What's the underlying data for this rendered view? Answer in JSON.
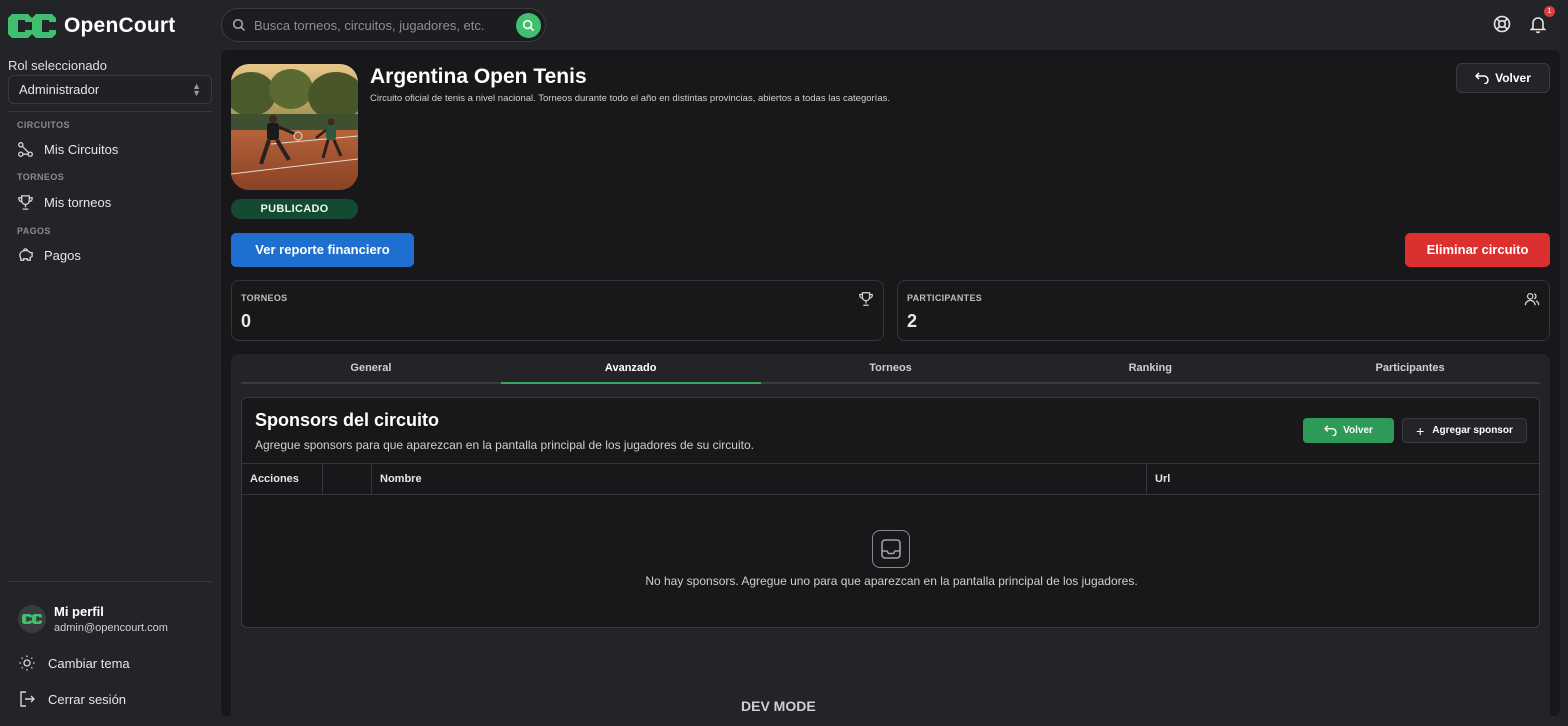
{
  "brand": {
    "name": "OpenCourt",
    "accent": "#3fbf6f"
  },
  "sidebar": {
    "role_label": "Rol seleccionado",
    "role_value": "Administrador",
    "sections": [
      {
        "label": "CIRCUITOS",
        "item": "Mis Circuitos",
        "icon": "circuit-icon"
      },
      {
        "label": "TORNEOS",
        "item": "Mis torneos",
        "icon": "trophy-icon"
      },
      {
        "label": "PAGOS",
        "item": "Pagos",
        "icon": "piggy-bank-icon"
      }
    ],
    "profile": {
      "name": "Mi perfil",
      "email": "admin@opencourt.com"
    },
    "theme_label": "Cambiar tema",
    "logout_label": "Cerrar sesión"
  },
  "search": {
    "placeholder": "Busca torneos, circuitos, jugadores, etc."
  },
  "notifications": {
    "count": "1"
  },
  "circuit": {
    "title": "Argentina Open Tenis",
    "description": "Circuito oficial de tenis a nivel nacional. Torneos durante todo el año en distintas provincias, abiertos a todas las categorías.",
    "status": "PUBLICADO",
    "back_label": "Volver",
    "report_label": "Ver reporte financiero",
    "delete_label": "Eliminar circuito"
  },
  "stats": [
    {
      "label": "TORNEOS",
      "value": "0",
      "icon": "trophy-icon"
    },
    {
      "label": "PARTICIPANTES",
      "value": "2",
      "icon": "users-icon"
    }
  ],
  "tabs": [
    "General",
    "Avanzado",
    "Torneos",
    "Ranking",
    "Participantes"
  ],
  "active_tab": "Avanzado",
  "sponsors": {
    "title": "Sponsors del circuito",
    "description": "Agregue sponsors para que aparezcan en la pantalla principal de los jugadores de su circuito.",
    "back_label": "Volver",
    "add_label": "Agregar sponsor",
    "columns": [
      "Acciones",
      "",
      "Nombre",
      "Url"
    ],
    "empty_text": "No hay sponsors. Agregue uno para que aparezcan en la pantalla principal de los jugadores."
  },
  "footer": {
    "dev_mode": "DEV MODE"
  }
}
